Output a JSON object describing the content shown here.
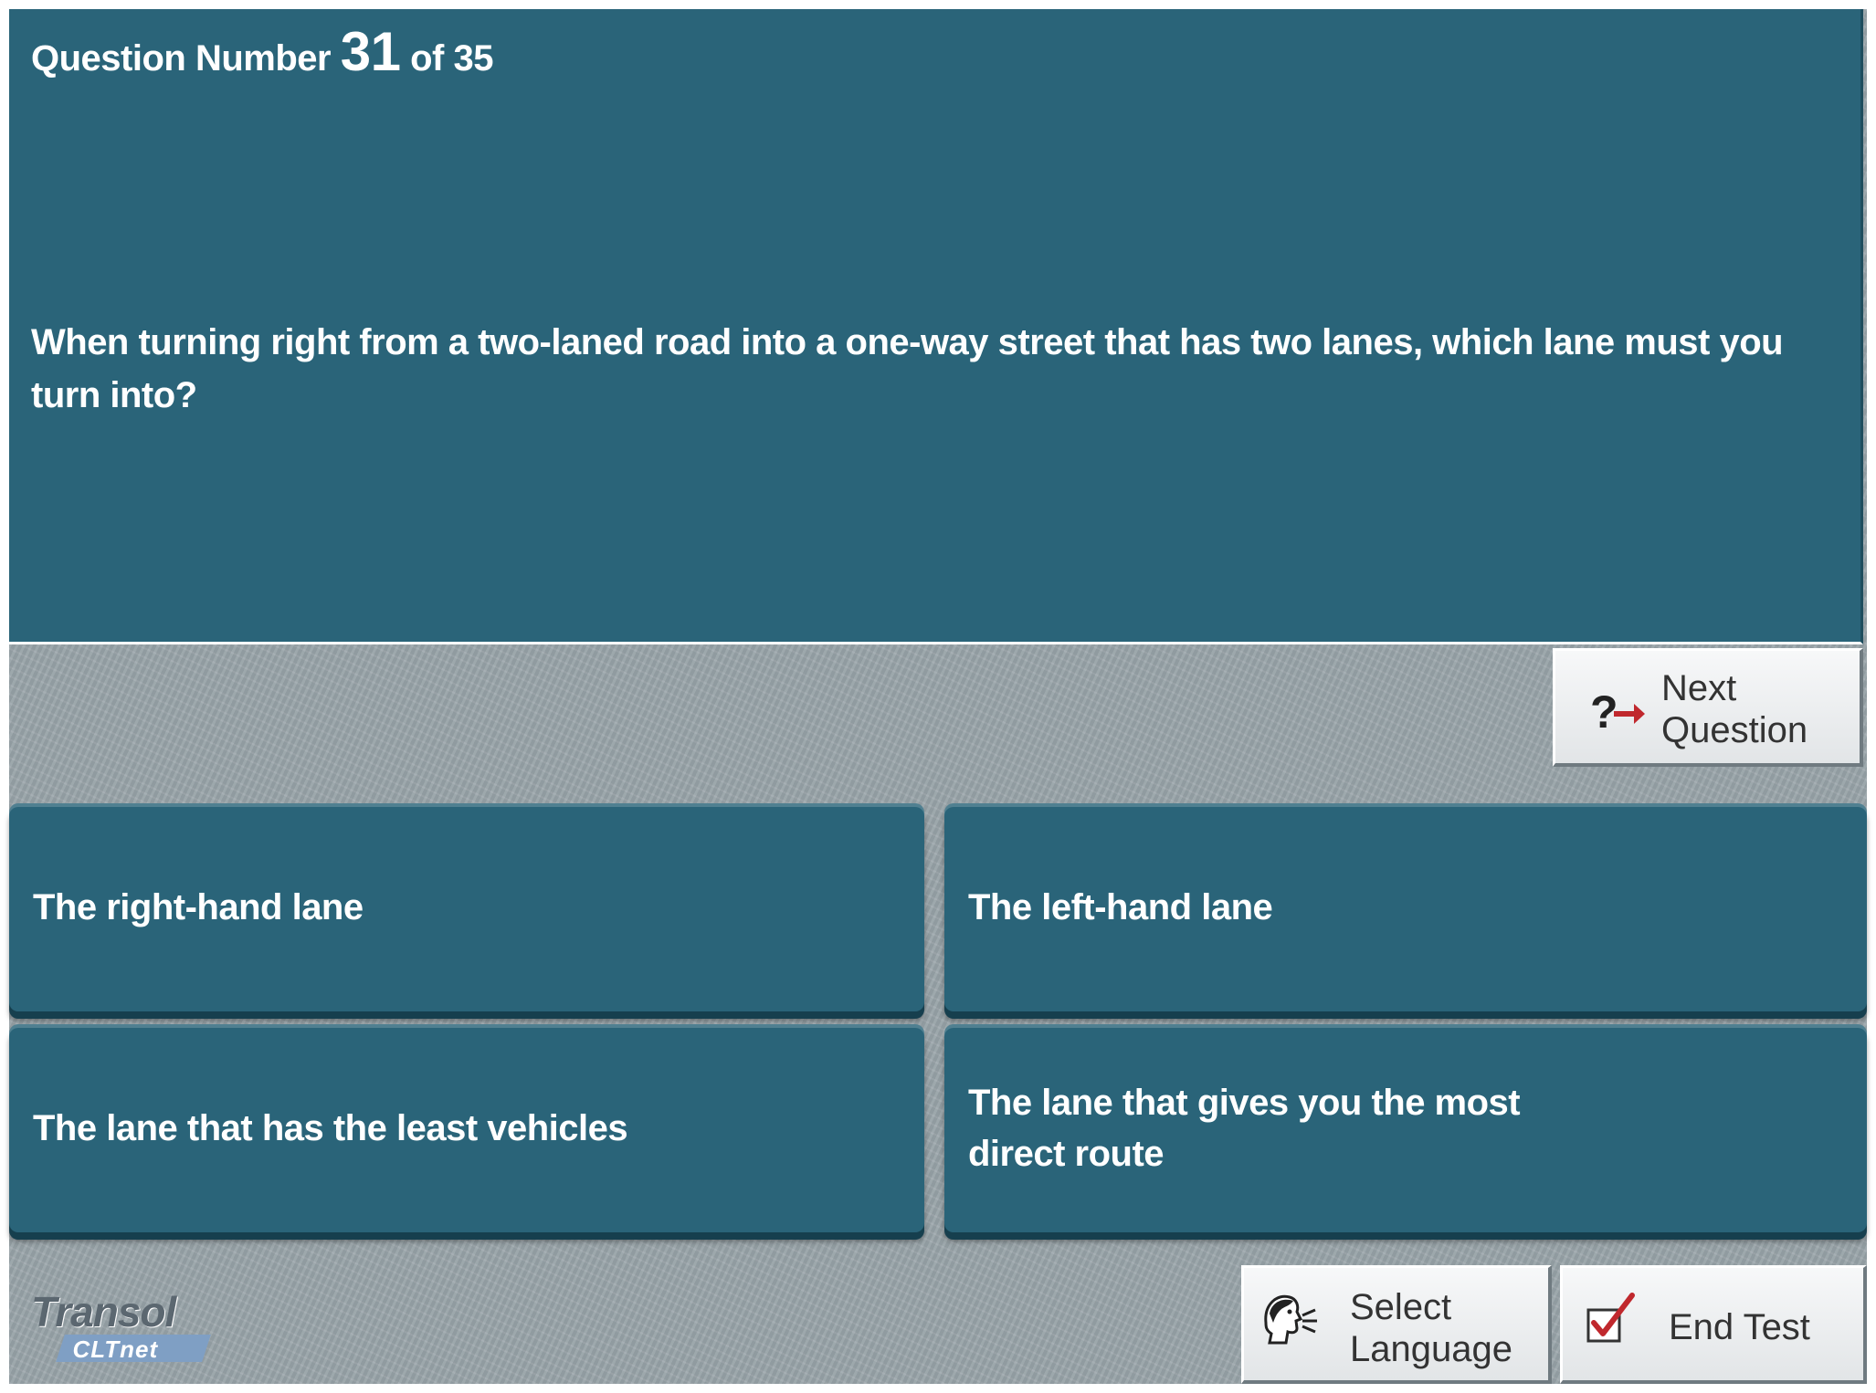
{
  "header": {
    "question_label": "Question Number",
    "question_number": "31",
    "of_label": "of 35"
  },
  "question": {
    "text": "When turning right from a two-laned road into a one-way street that has two lanes, which lane must you turn into?"
  },
  "next_button": {
    "icon": "question-arrow-icon",
    "line1": "Next",
    "line2": "Question"
  },
  "answers": [
    {
      "text": "The right-hand lane"
    },
    {
      "text": "The left-hand lane"
    },
    {
      "text": "The lane that has the least vehicles"
    },
    {
      "text": "The lane that gives you the most direct route"
    }
  ],
  "footer": {
    "logo_name": "Transol",
    "logo_sub": "CLTnet",
    "language_button": {
      "icon": "speaking-head-icon",
      "line1": "Select",
      "line2": "Language"
    },
    "end_button": {
      "icon": "checkbox-icon",
      "label": "End Test"
    }
  },
  "colors": {
    "panel": "#2a6479",
    "background": "#9ba6ab",
    "arrow": "#c0282d"
  }
}
